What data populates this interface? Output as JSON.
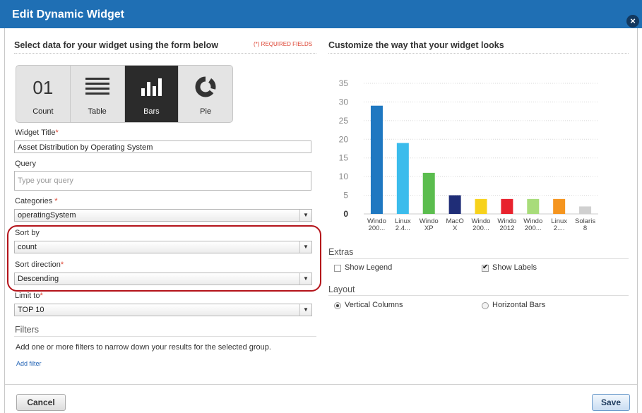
{
  "dialog": {
    "title": "Edit Dynamic Widget",
    "close": "×"
  },
  "left": {
    "heading": "Select data for your widget using the form below",
    "required_note": "(*) REQUIRED FIELDS",
    "viz_types": [
      {
        "label": "Count",
        "glyph": "01",
        "active": false
      },
      {
        "label": "Table",
        "active": false
      },
      {
        "label": "Bars",
        "active": true
      },
      {
        "label": "Pie",
        "active": false
      }
    ],
    "widget_title": {
      "label": "Widget Title",
      "value": "Asset Distribution by Operating System"
    },
    "query": {
      "label": "Query",
      "placeholder": "Type your query"
    },
    "categories": {
      "label": "Categories ",
      "value": "operatingSystem"
    },
    "sort_by": {
      "label": "Sort by",
      "value": "count"
    },
    "sort_direction": {
      "label": "Sort direction",
      "value": "Descending"
    },
    "limit_to": {
      "label": "Limit to",
      "value": "TOP 10"
    },
    "required_star": "*",
    "filters": {
      "heading": "Filters",
      "text": "Add one or more filters to narrow down your results for the selected group.",
      "add_link": "Add filter"
    }
  },
  "right": {
    "heading": "Customize the way that your widget looks",
    "extras": {
      "heading": "Extras",
      "show_legend": "Show Legend",
      "show_legend_checked": false,
      "show_labels": "Show Labels",
      "show_labels_checked": true
    },
    "layout": {
      "heading": "Layout",
      "vertical": "Vertical Columns",
      "horizontal": "Horizontal Bars",
      "selected": "vertical"
    }
  },
  "chart_data": {
    "type": "bar",
    "categories": [
      [
        "Windo",
        "200..."
      ],
      [
        "Linux",
        "2.4..."
      ],
      [
        "Windo",
        "XP"
      ],
      [
        "MacO",
        "X"
      ],
      [
        "Windo",
        "200..."
      ],
      [
        "Windo",
        "2012"
      ],
      [
        "Windo",
        "200..."
      ],
      [
        "Linux",
        "2...."
      ],
      [
        "Solaris",
        "8"
      ]
    ],
    "values": [
      29,
      19,
      11,
      5,
      4,
      4,
      4,
      4,
      2
    ],
    "colors": [
      "#1f78c1",
      "#3bbcec",
      "#5bbd4e",
      "#1f2d77",
      "#f7d21c",
      "#e8222d",
      "#a8dc7a",
      "#f5951f",
      "#d0d0d0"
    ],
    "ylim": [
      0,
      35
    ],
    "yticks": [
      0,
      5,
      10,
      15,
      20,
      25,
      30,
      35
    ],
    "grid": true
  },
  "footer": {
    "cancel": "Cancel",
    "save": "Save"
  }
}
